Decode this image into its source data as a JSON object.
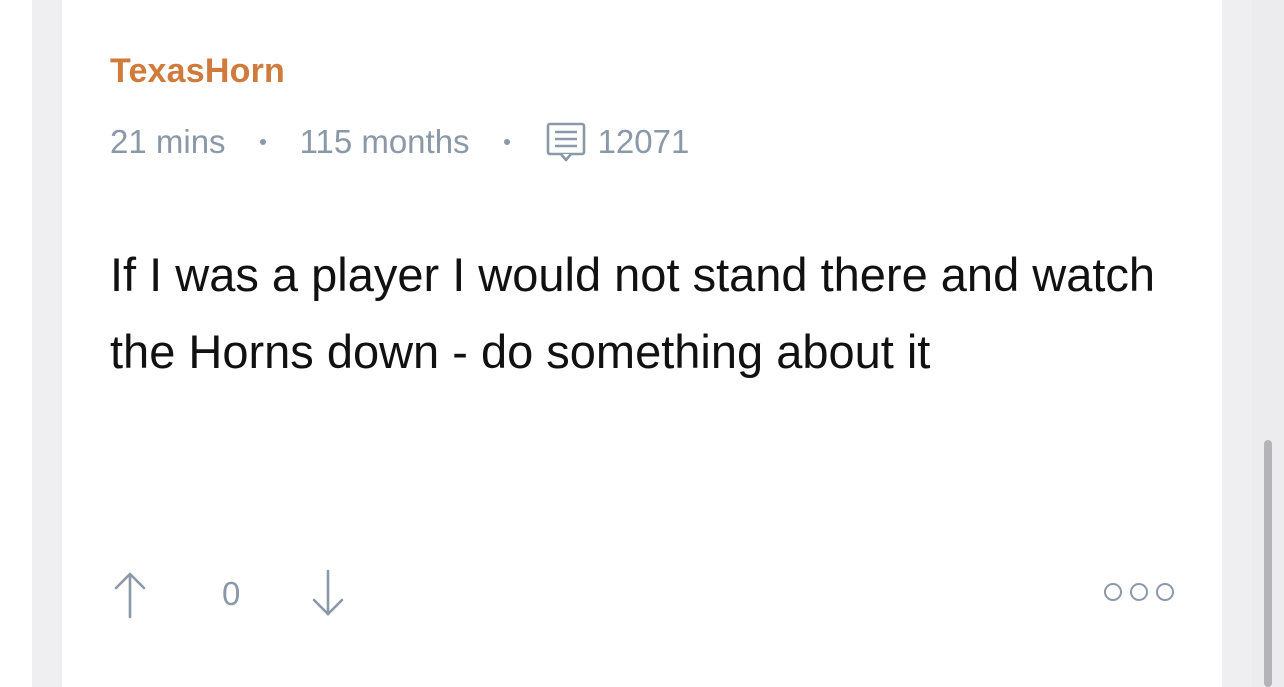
{
  "comment": {
    "username": "TexasHorn",
    "time_ago": "21 mins",
    "account_age": "115 months",
    "comment_count": "12071",
    "body": "If I was a player I would not stand there and watch the Horns down - do something about it",
    "vote_score": "0",
    "icons": {
      "comments": "comment-bubble-icon",
      "upvote": "arrow-up-icon",
      "downvote": "arrow-down-icon",
      "more": "more-options-icon"
    }
  },
  "colors": {
    "username": "#d07a3c",
    "meta": "#8a98a8",
    "body": "#111111"
  }
}
